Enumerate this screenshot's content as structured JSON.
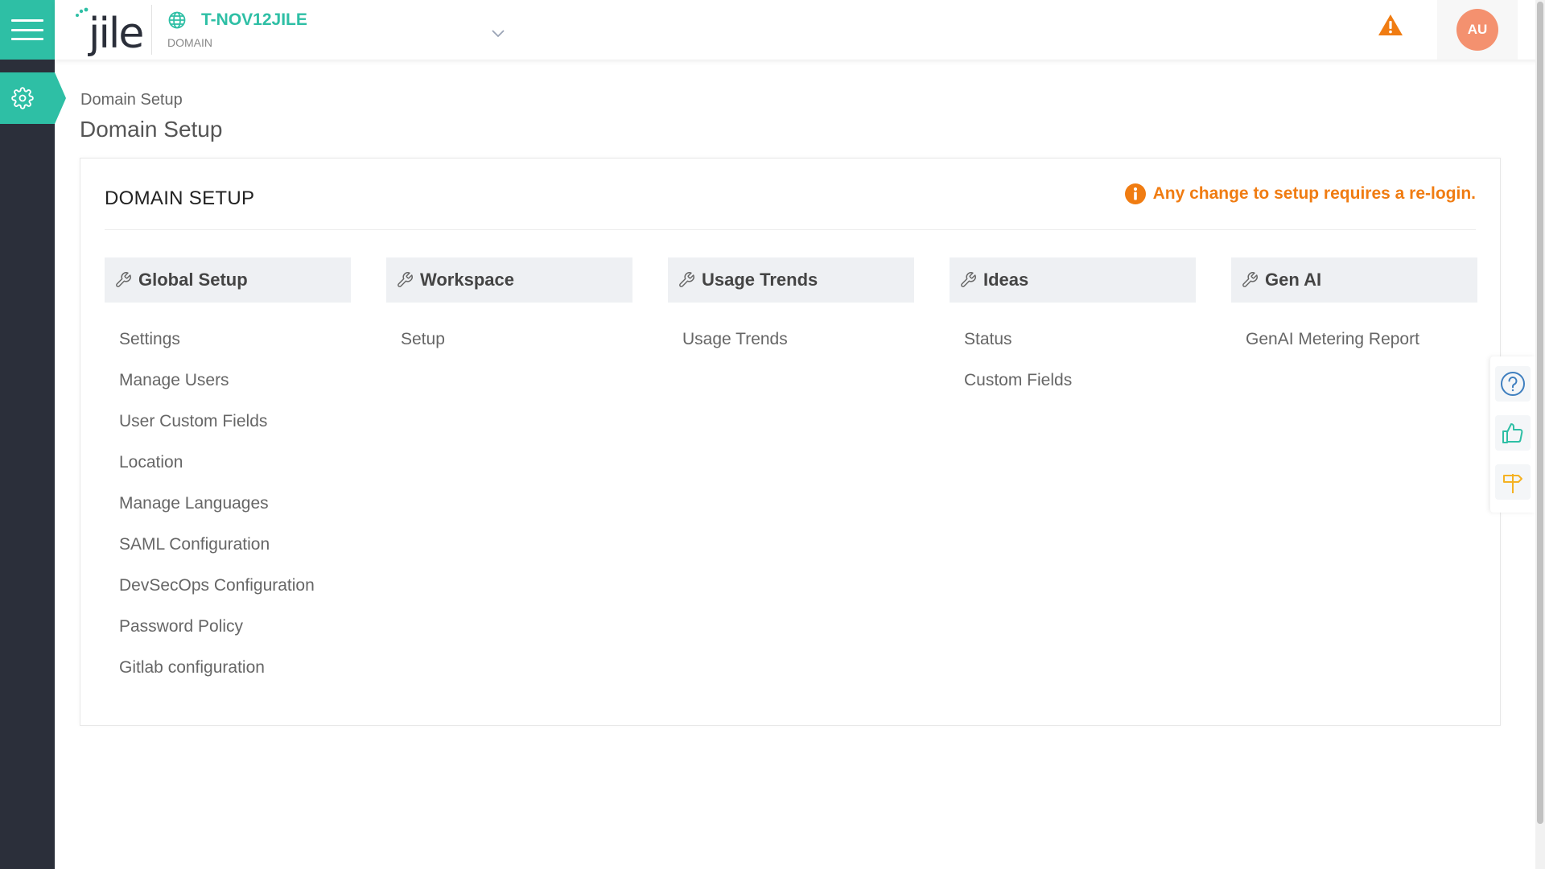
{
  "app": {
    "logo_text": "jile",
    "domain_name": "T-NOV12JILE",
    "domain_type": "DOMAIN",
    "user_initials": "AU"
  },
  "page": {
    "breadcrumb": "Domain Setup",
    "title": "Domain Setup"
  },
  "card": {
    "title": "DOMAIN SETUP",
    "note": "Any change to setup requires a re-login."
  },
  "columns": [
    {
      "title": "Global Setup",
      "items": [
        "Settings",
        "Manage Users",
        "User Custom Fields",
        "Location",
        "Manage Languages",
        "SAML Configuration",
        "DevSecOps Configuration",
        "Password Policy",
        "Gitlab configuration"
      ]
    },
    {
      "title": "Workspace",
      "items": [
        "Setup"
      ]
    },
    {
      "title": "Usage Trends",
      "items": [
        "Usage Trends"
      ]
    },
    {
      "title": "Ideas",
      "items": [
        "Status",
        "Custom Fields"
      ]
    },
    {
      "title": "Gen AI",
      "items": [
        "GenAI Metering Report"
      ]
    }
  ],
  "icons": {
    "menu": "hamburger-menu-icon",
    "settings": "gear-icon",
    "domain": "globe-icon",
    "dropdown": "chevron-down-icon",
    "alert": "warning-triangle-icon",
    "note": "info-circle-icon",
    "section": "wrench-icon",
    "help": "question-circle-icon",
    "feedback": "thumbs-up-icon",
    "roadmap": "signpost-icon"
  },
  "colors": {
    "brand_teal": "#2ebfa5",
    "rail_dark": "#2b2f3a",
    "warning_orange": "#f07c12",
    "avatar_bg": "#f4916f",
    "help_blue": "#3f7fbf",
    "signpost_yellow": "#f5b223"
  }
}
